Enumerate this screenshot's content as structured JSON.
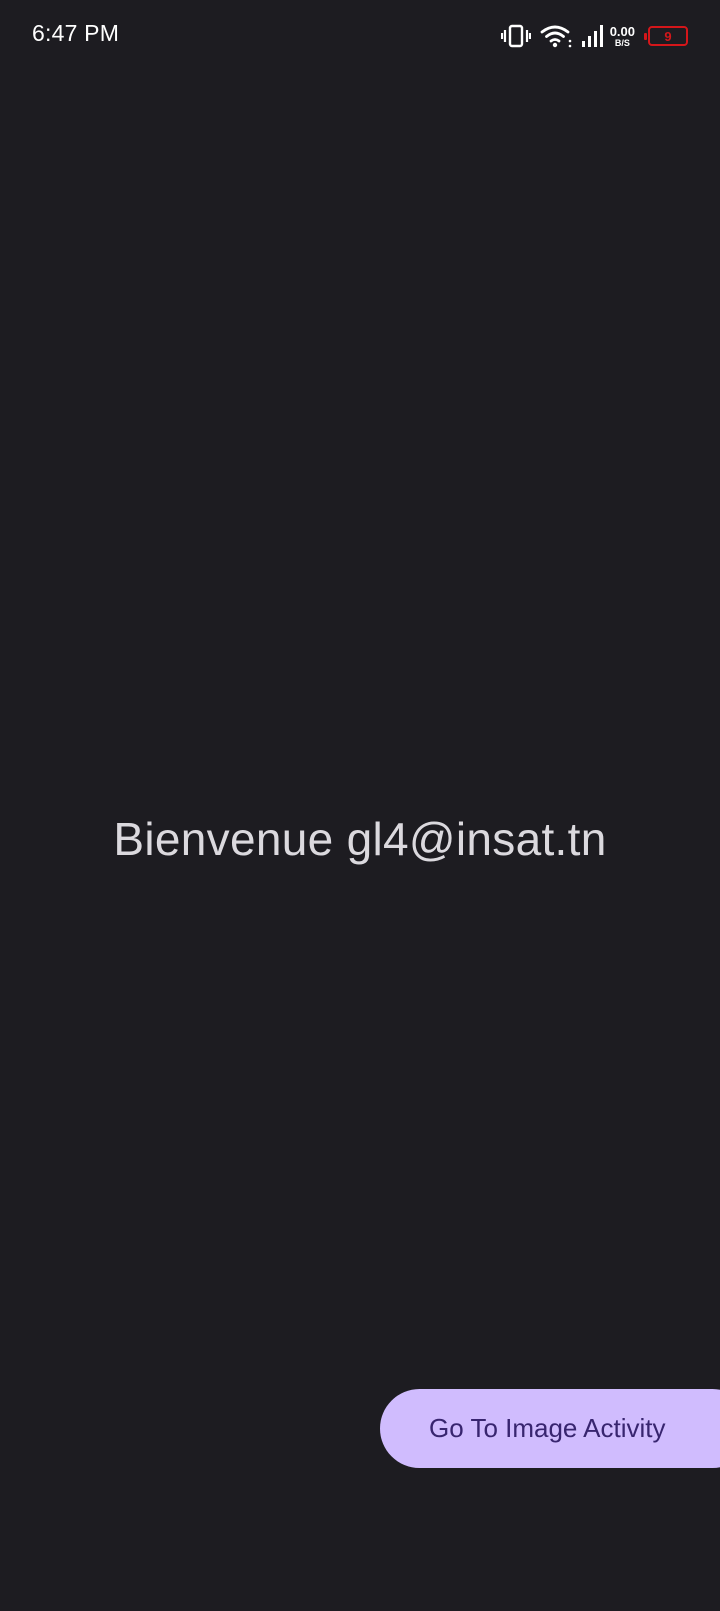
{
  "status_bar": {
    "time": "6:47 PM",
    "icons": [
      "vibrate-icon",
      "wifi-icon",
      "signal-icon"
    ],
    "net_speed_value": "0.00",
    "net_speed_unit": "B/S",
    "battery_level": "9",
    "battery_color": "#d4161a"
  },
  "main": {
    "welcome_text": "Bienvenue gl4@insat.tn"
  },
  "action_button": {
    "label": "Go To Image Activity",
    "background_color": "#d0bcfe",
    "text_color": "#38256f"
  },
  "theme": {
    "background": "#1d1c21",
    "text_color": "#dbd9de"
  }
}
